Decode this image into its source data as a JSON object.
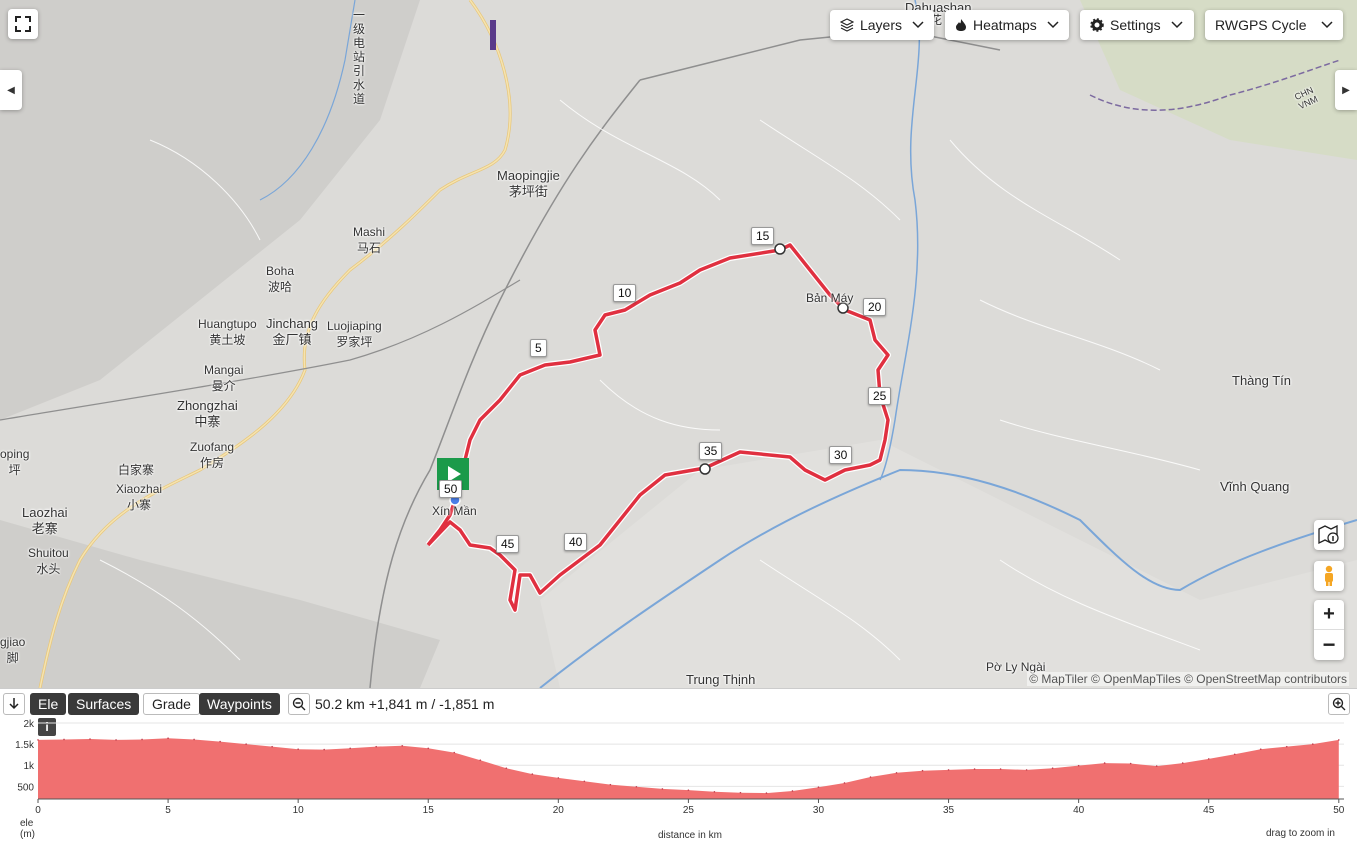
{
  "toolbar": {
    "layers_label": "Layers",
    "heatmaps_label": "Heatmaps",
    "settings_label": "Settings",
    "basemap_label": "RWGPS Cycle"
  },
  "map": {
    "places": [
      {
        "id": "dahuashan",
        "name": "Dahuashan"
      },
      {
        "id": "maopingjie",
        "name": "Maopingjie",
        "sub": "茅坪街"
      },
      {
        "id": "mashi",
        "name": "Mashi",
        "sub": "马石"
      },
      {
        "id": "boha",
        "name": "Boha",
        "sub": "波哈"
      },
      {
        "id": "huangtupo",
        "name": "Huangtupo",
        "sub": "黄土坡"
      },
      {
        "id": "jinchang",
        "name": "Jinchang",
        "sub": "金厂镇"
      },
      {
        "id": "luojiaping",
        "name": "Luojiaping",
        "sub": "罗家坪"
      },
      {
        "id": "mangai",
        "name": "Mangai",
        "sub": "曼介"
      },
      {
        "id": "zhongzhai",
        "name": "Zhongzhai",
        "sub": "中寨"
      },
      {
        "id": "zuofang",
        "name": "Zuofang",
        "sub": "作房"
      },
      {
        "id": "baijiazhai",
        "name": "白家寨"
      },
      {
        "id": "xiaozhai",
        "name": "Xiaozhai",
        "sub": "小寨"
      },
      {
        "id": "laozhai",
        "name": "Laozhai",
        "sub": "老寨"
      },
      {
        "id": "shuitou",
        "name": "Shuitou",
        "sub": "水头"
      },
      {
        "id": "oping",
        "name": "oping",
        "sub": "坪"
      },
      {
        "id": "gjiao",
        "name": "gjiao",
        "sub": "脚"
      },
      {
        "id": "banmay",
        "name": "Bản Máy"
      },
      {
        "id": "xinman",
        "name": "Xín Mần"
      },
      {
        "id": "thangtin",
        "name": "Thàng Tín"
      },
      {
        "id": "vinhquang",
        "name": "Vĩnh Quang"
      },
      {
        "id": "polyngai",
        "name": "Pờ Ly Ngài"
      },
      {
        "id": "trungthinh",
        "name": "Trung Thịnh"
      }
    ],
    "canal_label": "一级电站引水道",
    "hua_char": "花",
    "border_label_top": "CHN",
    "border_label_bottom": "VNM",
    "km_markers": [
      "5",
      "10",
      "15",
      "20",
      "25",
      "30",
      "35",
      "40",
      "45",
      "50"
    ],
    "attribution": "© MapTiler © OpenMapTiles © OpenStreetMap contributors",
    "route_color": "#e03040"
  },
  "elevation_panel": {
    "tabs": [
      "Ele",
      "Surfaces",
      "Grade",
      "Waypoints"
    ],
    "active_tabs": [
      "Ele",
      "Surfaces",
      "Waypoints"
    ],
    "summary": "50.2 km +1,841 m / -1,851 m",
    "y_axis_label": "ele",
    "y_axis_unit": "(m)",
    "x_axis_label": "distance in km",
    "hint": "drag to zoom in",
    "info_icon": "i"
  },
  "chart_data": {
    "type": "area",
    "x": [
      0,
      1,
      2,
      3,
      4,
      5,
      6,
      7,
      8,
      9,
      10,
      11,
      12,
      13,
      14,
      15,
      16,
      17,
      18,
      19,
      20,
      21,
      22,
      23,
      24,
      25,
      26,
      27,
      28,
      29,
      30,
      31,
      32,
      33,
      34,
      35,
      36,
      37,
      38,
      39,
      40,
      41,
      42,
      43,
      44,
      45,
      46,
      47,
      48,
      49,
      50
    ],
    "y": [
      1600,
      1610,
      1620,
      1600,
      1610,
      1640,
      1610,
      1560,
      1500,
      1440,
      1380,
      1370,
      1400,
      1440,
      1460,
      1400,
      1300,
      1120,
      930,
      790,
      700,
      620,
      540,
      490,
      440,
      410,
      370,
      350,
      340,
      390,
      480,
      580,
      720,
      820,
      870,
      890,
      910,
      910,
      890,
      930,
      990,
      1050,
      1040,
      980,
      1050,
      1150,
      1260,
      1380,
      1440,
      1500,
      1600
    ],
    "xlabel": "distance in km",
    "ylabel": "ele (m)",
    "xlim": [
      0,
      50.2
    ],
    "ylim": [
      200,
      2000
    ],
    "x_ticks": [
      0,
      5,
      10,
      15,
      20,
      25,
      30,
      35,
      40,
      45,
      50
    ],
    "y_ticks": [
      {
        "value": 2000,
        "label": "2k"
      },
      {
        "value": 1500,
        "label": "1.5k"
      },
      {
        "value": 1000,
        "label": "1k"
      },
      {
        "value": 500,
        "label": "500"
      }
    ],
    "fill_color": "#f07070"
  }
}
